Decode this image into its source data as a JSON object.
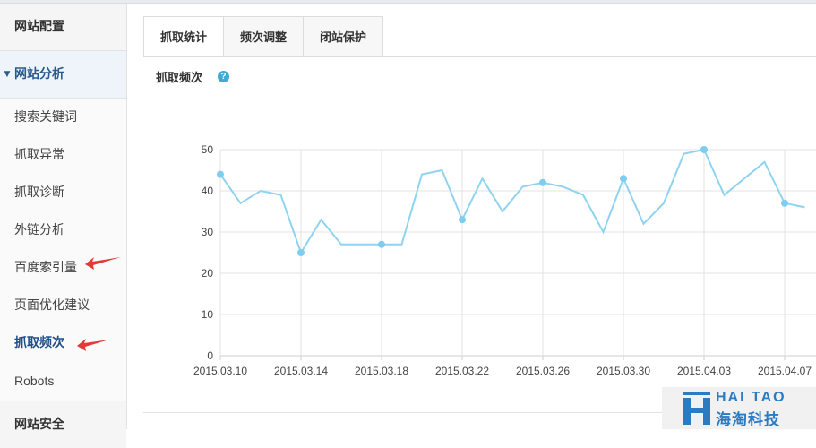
{
  "sidebar": {
    "section_config": "网站配置",
    "section_analysis": "网站分析",
    "items": [
      {
        "label": "搜索关键词"
      },
      {
        "label": "抓取异常"
      },
      {
        "label": "抓取诊断"
      },
      {
        "label": "外链分析"
      },
      {
        "label": "百度索引量"
      },
      {
        "label": "页面优化建议"
      },
      {
        "label": "抓取频次"
      },
      {
        "label": "Robots"
      }
    ],
    "section_security": "网站安全"
  },
  "tabs": [
    {
      "label": "抓取统计"
    },
    {
      "label": "频次调整"
    },
    {
      "label": "闭站保护"
    }
  ],
  "section": {
    "title": "抓取频次",
    "help_glyph": "?"
  },
  "colors": {
    "line": "#8fd3f0",
    "marker": "#7fcdee",
    "grid": "#e3e3e3",
    "annotation_arrow": "#e53935",
    "accent": "#2a5a8c"
  },
  "chart_data": {
    "type": "line",
    "title": "",
    "xlabel": "",
    "ylabel": "",
    "ylim": [
      0,
      50
    ],
    "yticks": [
      0,
      10,
      20,
      30,
      40,
      50
    ],
    "xtick_labels": [
      "2015.03.10",
      "2015.03.14",
      "2015.03.18",
      "2015.03.22",
      "2015.03.26",
      "2015.03.30",
      "2015.04.03",
      "2015.04.07"
    ],
    "x": [
      "2015.03.10",
      "2015.03.11",
      "2015.03.12",
      "2015.03.13",
      "2015.03.14",
      "2015.03.15",
      "2015.03.16",
      "2015.03.17",
      "2015.03.18",
      "2015.03.19",
      "2015.03.20",
      "2015.03.21",
      "2015.03.22",
      "2015.03.23",
      "2015.03.24",
      "2015.03.25",
      "2015.03.26",
      "2015.03.27",
      "2015.03.28",
      "2015.03.29",
      "2015.03.30",
      "2015.03.31",
      "2015.04.01",
      "2015.04.02",
      "2015.04.03",
      "2015.04.04",
      "2015.04.05",
      "2015.04.06",
      "2015.04.07",
      "2015.04.08"
    ],
    "values": [
      44,
      37,
      40,
      39,
      25,
      33,
      27,
      27,
      27,
      27,
      44,
      45,
      33,
      43,
      35,
      41,
      42,
      41,
      39,
      30,
      43,
      32,
      37,
      49,
      50,
      39,
      43,
      47,
      37,
      36
    ],
    "markers": [
      "2015.03.10",
      "2015.03.14",
      "2015.03.18",
      "2015.03.22",
      "2015.03.26",
      "2015.03.30",
      "2015.04.03",
      "2015.04.07"
    ],
    "grid": true,
    "legend": "none"
  },
  "watermark": {
    "line1": "HAI TAO",
    "line2": "海淘科技"
  }
}
